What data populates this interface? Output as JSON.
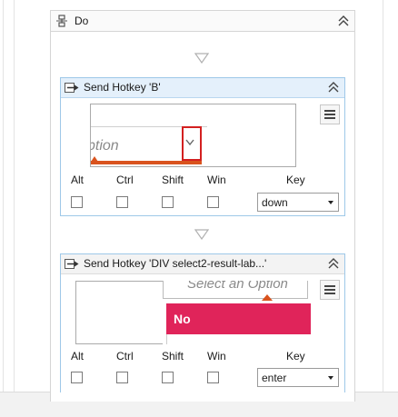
{
  "sequence": {
    "title": "Do"
  },
  "activities": [
    {
      "title": "Send Hotkey 'B'",
      "preview": {
        "placeholder_fragment": "ption"
      },
      "modifiers": [
        "Alt",
        "Ctrl",
        "Shift",
        "Win"
      ],
      "key_label": "Key",
      "key_value": "down"
    },
    {
      "title": "Send Hotkey 'DIV  select2-result-lab...'",
      "preview": {
        "placeholder": "Select an Option",
        "highlighted_option": "No"
      },
      "modifiers": [
        "Alt",
        "Ctrl",
        "Shift",
        "Win"
      ],
      "key_label": "Key",
      "key_value": "enter"
    }
  ],
  "colors": {
    "header_bg": "#e4f0fb",
    "activity_border": "#9ec8e8",
    "highlight_option": "#e0245a",
    "selector_outline": "#d32020",
    "accent_orange": "#d9531e"
  },
  "icons": [
    "sequence-icon",
    "collapse-chevrons-icon",
    "send-hotkey-icon",
    "hamburger-menu-icon",
    "dropdown-arrow-icon",
    "connector-arrow-icon"
  ]
}
